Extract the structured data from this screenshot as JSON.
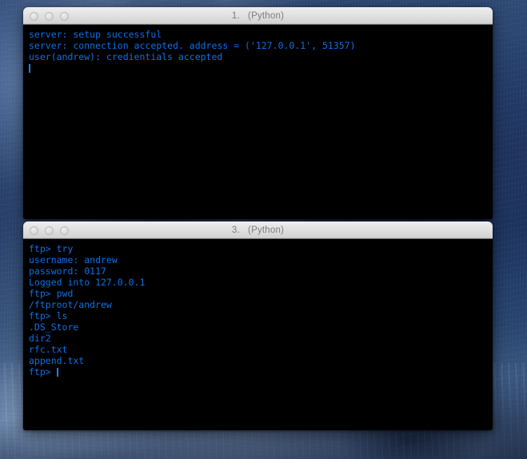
{
  "desktop": {
    "wallpaper_name": "glacier-ice-wallpaper",
    "base_color": "#24406d"
  },
  "theme": {
    "terminal_background": "#000000",
    "terminal_text": "#0d6fe8",
    "titlebar_text": "#7d7d7d",
    "titlebar_background": "#e2e2e2"
  },
  "windows": [
    {
      "id": "window-1",
      "title": "1.   (Python)",
      "traffic_lights": [
        "close-button",
        "minimize-button",
        "zoom-button"
      ],
      "lines": [
        "server: setup successful",
        "server: connection accepted. address = ('127.0.0.1', 51357)",
        "user(andrew): credientials accepted"
      ],
      "prompt_line": "",
      "has_cursor": true
    },
    {
      "id": "window-2",
      "title": "3.   (Python)",
      "traffic_lights": [
        "close-button",
        "minimize-button",
        "zoom-button"
      ],
      "lines": [
        "ftp> try",
        "username: andrew",
        "password: 0117",
        "Logged into 127.0.0.1",
        "ftp> pwd",
        "/ftproot/andrew",
        "ftp> ls",
        ".DS_Store",
        "dir2",
        "rfc.txt",
        "append.txt"
      ],
      "prompt_line": "ftp> ",
      "has_cursor": true
    }
  ]
}
